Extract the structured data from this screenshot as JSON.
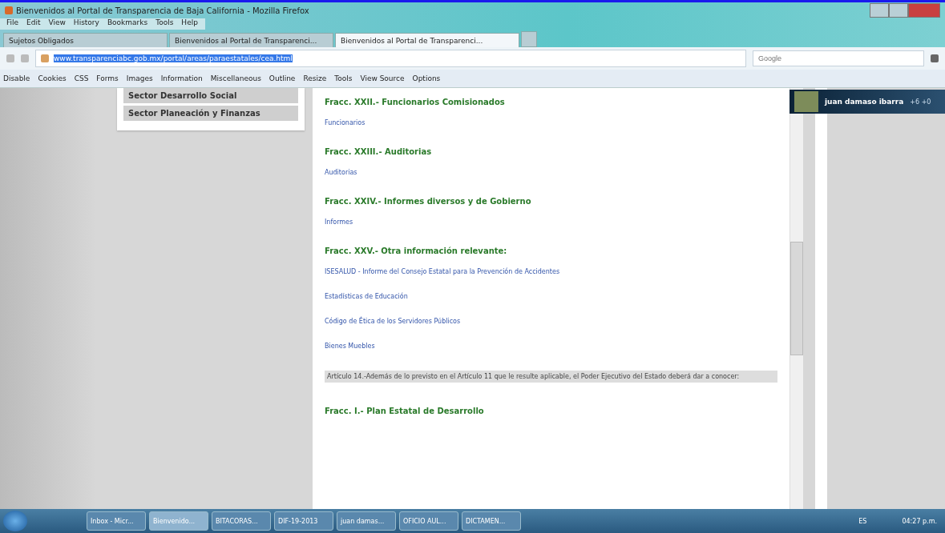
{
  "window": {
    "title": "Bienvenidos al Portal de Transparencia de Baja California - Mozilla Firefox"
  },
  "menu": [
    "File",
    "Edit",
    "View",
    "History",
    "Bookmarks",
    "Tools",
    "Help"
  ],
  "tabs": [
    {
      "label": "Sujetos Obligados",
      "selected": false
    },
    {
      "label": "Bienvenidos al Portal de Transparenci...",
      "selected": false
    },
    {
      "label": "Bienvenidos al Portal de Transparenci...",
      "selected": true
    }
  ],
  "address": {
    "value": "www.transparenciabc.gob.mx/portal/areas/paraestatales/cea.html"
  },
  "search": {
    "placeholder": "Google"
  },
  "devbar": [
    "Disable",
    "Cookies",
    "CSS",
    "Forms",
    "Images",
    "Information",
    "Miscellaneous",
    "Outline",
    "Resize",
    "Tools",
    "View Source",
    "Options"
  ],
  "profile": {
    "name": "juan damaso ibarra",
    "badge": "+6 +0"
  },
  "sidebar": {
    "items": [
      "Sector Desarrollo Social",
      "Sector Planeación y Finanzas"
    ]
  },
  "sections": [
    {
      "heading": "Fracc. XXII.- Funcionarios Comisionados",
      "links": [
        "Funcionarios"
      ]
    },
    {
      "heading": "Fracc. XXIII.- Auditorias",
      "links": [
        "Auditorias"
      ]
    },
    {
      "heading": "Fracc. XXIV.- Informes diversos y de Gobierno",
      "links": [
        "Informes"
      ]
    },
    {
      "heading": "Fracc. XXV.- Otra información relevante:",
      "links": [
        "ISESALUD - Informe del Consejo Estatal para la Prevención de Accidentes",
        "Estadísticas de Educación",
        "Código de Ética de los Servidores Públicos",
        "Bienes Muebles"
      ]
    }
  ],
  "note": "Artículo 14.-Además de lo previsto en el Artículo 11 que le resulte aplicable, el Poder Ejecutivo del Estado deberá dar a conocer:",
  "last_heading": "Fracc. I.- Plan Estatal de Desarrollo",
  "taskbar": {
    "items": [
      {
        "label": "Inbox - Micr...",
        "selected": false
      },
      {
        "label": "Bienvenido...",
        "selected": true
      },
      {
        "label": "BITACORAS...",
        "selected": false
      },
      {
        "label": "DIF-19-2013",
        "selected": false
      },
      {
        "label": "juan damas...",
        "selected": false
      },
      {
        "label": "OFICIO AUL...",
        "selected": false
      },
      {
        "label": "DICTAMEN...",
        "selected": false
      }
    ],
    "lang": "ES",
    "time": "04:27 p.m."
  }
}
